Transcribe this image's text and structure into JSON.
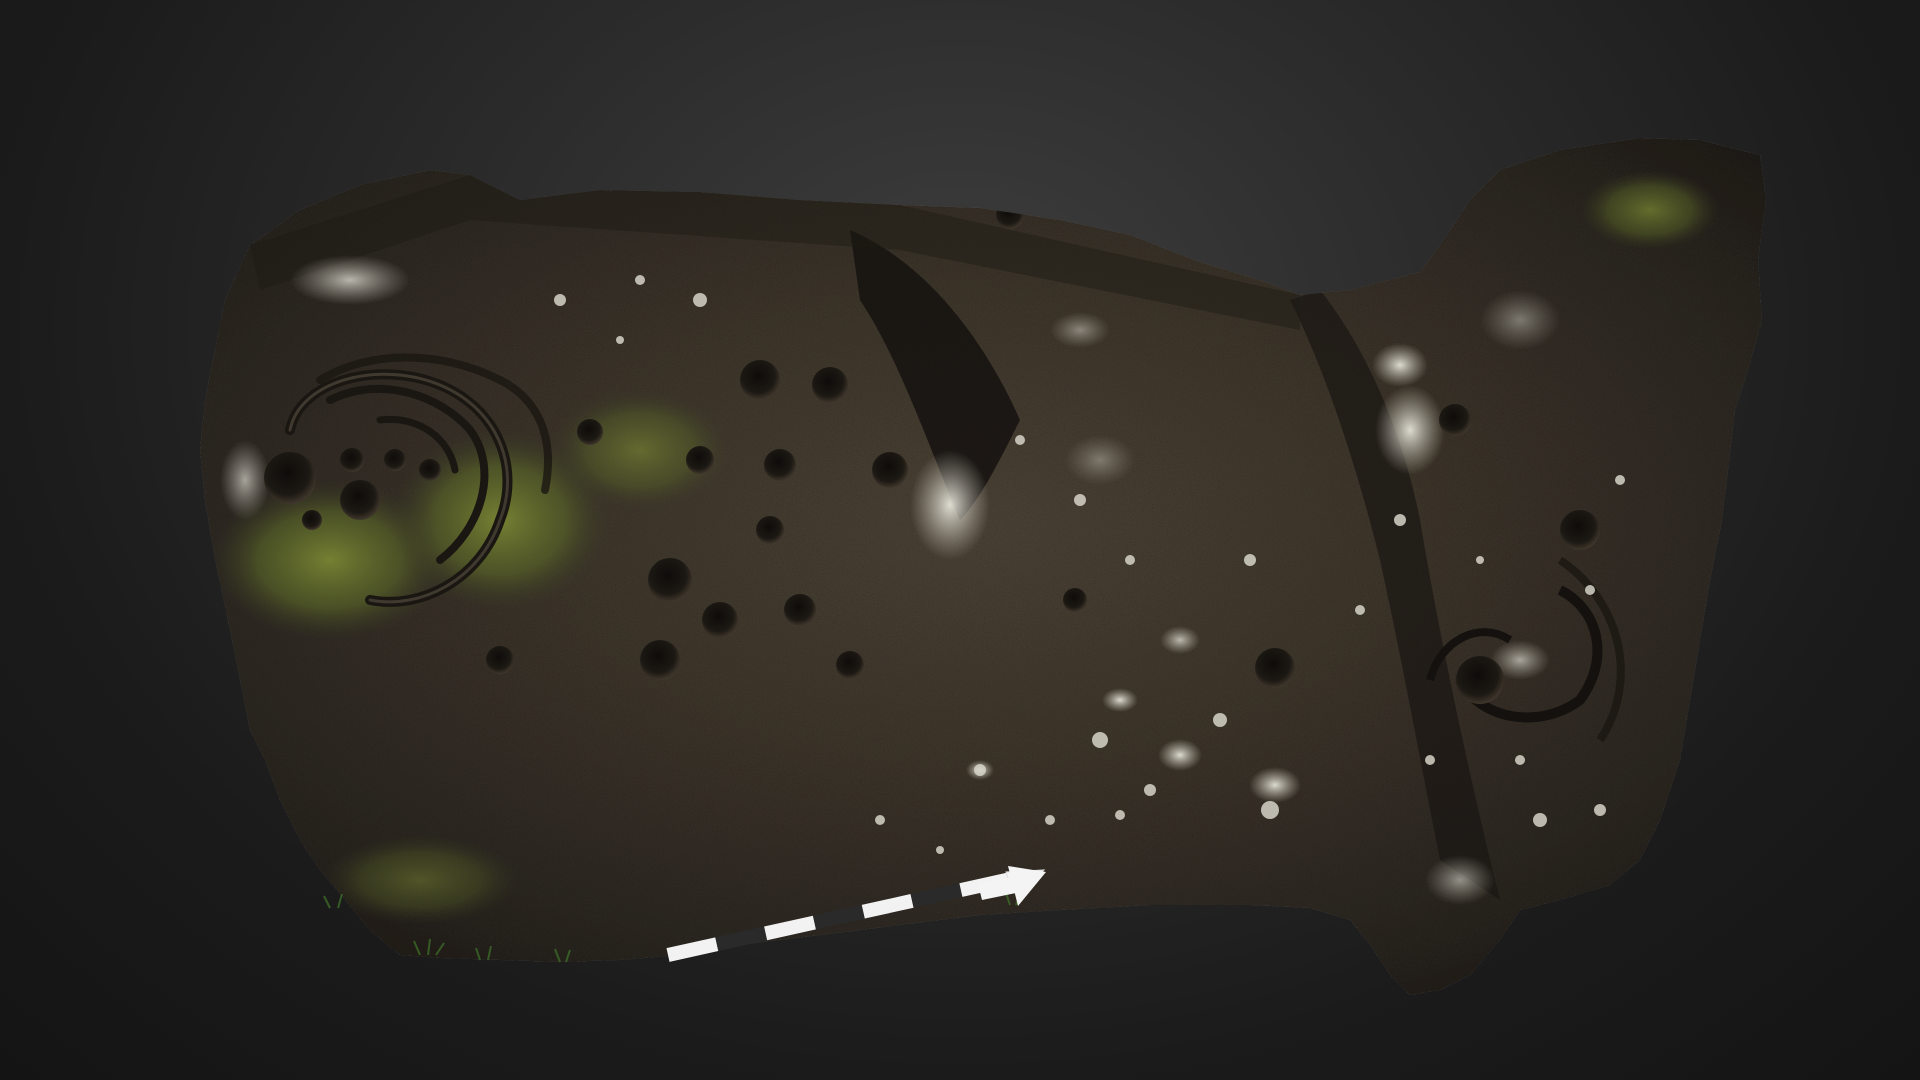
{
  "scene": {
    "subject": "rock-art-stone",
    "background_colors": [
      "#3e3e3e",
      "#2c2c2c",
      "#1b1b1b",
      "#141414"
    ],
    "rock_colors": [
      "#2b2620",
      "#3a3329",
      "#4a4135",
      "#5d5445"
    ],
    "moss_color": "#6a7a2c",
    "lichen_color": "#d8d6cc",
    "scale_bar_colors": [
      "#f2f2f2",
      "#2a2a2a"
    ],
    "arrow_color": "#f4f4f4"
  }
}
